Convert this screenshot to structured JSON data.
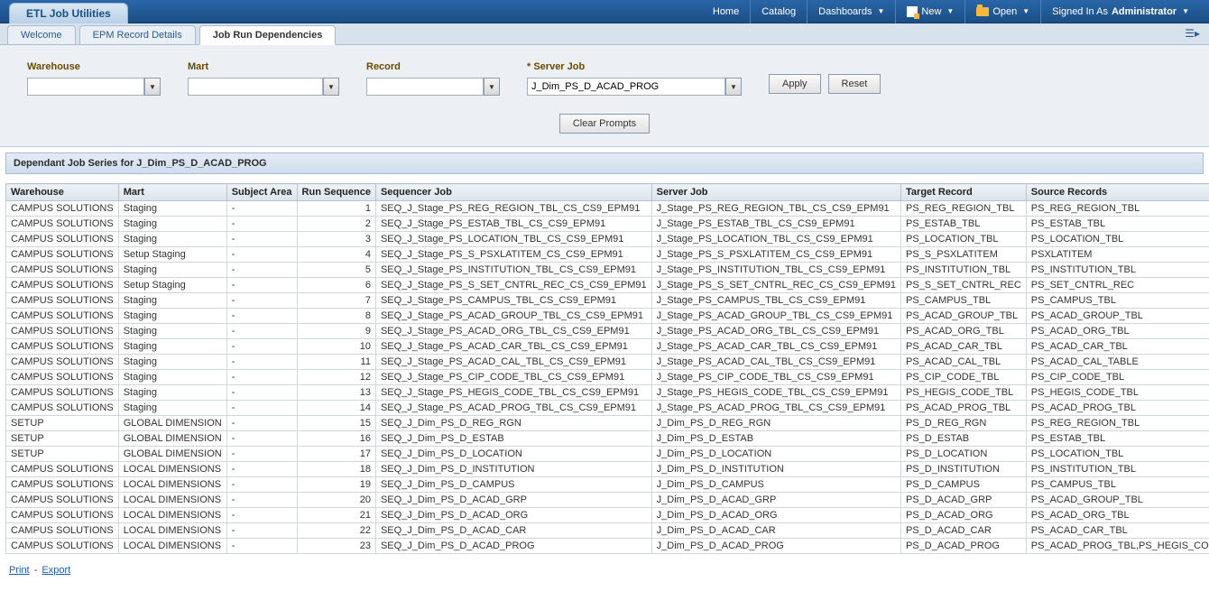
{
  "header": {
    "app_title": "ETL Job Utilities",
    "nav": {
      "home": "Home",
      "catalog": "Catalog",
      "dashboards": "Dashboards",
      "new": "New",
      "open": "Open",
      "signed_in_prefix": "Signed In As ",
      "signed_in_user": "Administrator"
    }
  },
  "tabs": {
    "items": [
      {
        "label": "Welcome",
        "active": false
      },
      {
        "label": "EPM Record Details",
        "active": false
      },
      {
        "label": "Job Run Dependencies",
        "active": true
      }
    ]
  },
  "prompts": {
    "warehouse": {
      "label": "Warehouse",
      "value": ""
    },
    "mart": {
      "label": "Mart",
      "value": ""
    },
    "record": {
      "label": "Record",
      "value": ""
    },
    "server_job": {
      "label": "* Server Job",
      "value": "J_Dim_PS_D_ACAD_PROG"
    },
    "apply": "Apply",
    "reset": "Reset",
    "clear": "Clear Prompts"
  },
  "section_title": "Dependant Job Series for J_Dim_PS_D_ACAD_PROG",
  "table": {
    "columns": [
      "Warehouse",
      "Mart",
      "Subject Area",
      "Run Sequence",
      "Sequencer Job",
      "Server Job",
      "Target Record",
      "Source Records"
    ],
    "rows": [
      {
        "warehouse": "CAMPUS SOLUTIONS",
        "mart": "Staging",
        "subject": "-",
        "seq": 1,
        "sequencer": "SEQ_J_Stage_PS_REG_REGION_TBL_CS_CS9_EPM91",
        "server": "J_Stage_PS_REG_REGION_TBL_CS_CS9_EPM91",
        "target": "PS_REG_REGION_TBL",
        "source": "PS_REG_REGION_TBL"
      },
      {
        "warehouse": "CAMPUS SOLUTIONS",
        "mart": "Staging",
        "subject": "-",
        "seq": 2,
        "sequencer": "SEQ_J_Stage_PS_ESTAB_TBL_CS_CS9_EPM91",
        "server": "J_Stage_PS_ESTAB_TBL_CS_CS9_EPM91",
        "target": "PS_ESTAB_TBL",
        "source": "PS_ESTAB_TBL"
      },
      {
        "warehouse": "CAMPUS SOLUTIONS",
        "mart": "Staging",
        "subject": "-",
        "seq": 3,
        "sequencer": "SEQ_J_Stage_PS_LOCATION_TBL_CS_CS9_EPM91",
        "server": "J_Stage_PS_LOCATION_TBL_CS_CS9_EPM91",
        "target": "PS_LOCATION_TBL",
        "source": "PS_LOCATION_TBL"
      },
      {
        "warehouse": "CAMPUS SOLUTIONS",
        "mart": "Setup Staging",
        "subject": "-",
        "seq": 4,
        "sequencer": "SEQ_J_Stage_PS_S_PSXLATITEM_CS_CS9_EPM91",
        "server": "J_Stage_PS_S_PSXLATITEM_CS_CS9_EPM91",
        "target": "PS_S_PSXLATITEM",
        "source": "PSXLATITEM"
      },
      {
        "warehouse": "CAMPUS SOLUTIONS",
        "mart": "Staging",
        "subject": "-",
        "seq": 5,
        "sequencer": "SEQ_J_Stage_PS_INSTITUTION_TBL_CS_CS9_EPM91",
        "server": "J_Stage_PS_INSTITUTION_TBL_CS_CS9_EPM91",
        "target": "PS_INSTITUTION_TBL",
        "source": "PS_INSTITUTION_TBL"
      },
      {
        "warehouse": "CAMPUS SOLUTIONS",
        "mart": "Setup Staging",
        "subject": "-",
        "seq": 6,
        "sequencer": "SEQ_J_Stage_PS_S_SET_CNTRL_REC_CS_CS9_EPM91",
        "server": "J_Stage_PS_S_SET_CNTRL_REC_CS_CS9_EPM91",
        "target": "PS_S_SET_CNTRL_REC",
        "source": "PS_SET_CNTRL_REC"
      },
      {
        "warehouse": "CAMPUS SOLUTIONS",
        "mart": "Staging",
        "subject": "-",
        "seq": 7,
        "sequencer": "SEQ_J_Stage_PS_CAMPUS_TBL_CS_CS9_EPM91",
        "server": "J_Stage_PS_CAMPUS_TBL_CS_CS9_EPM91",
        "target": "PS_CAMPUS_TBL",
        "source": "PS_CAMPUS_TBL"
      },
      {
        "warehouse": "CAMPUS SOLUTIONS",
        "mart": "Staging",
        "subject": "-",
        "seq": 8,
        "sequencer": "SEQ_J_Stage_PS_ACAD_GROUP_TBL_CS_CS9_EPM91",
        "server": "J_Stage_PS_ACAD_GROUP_TBL_CS_CS9_EPM91",
        "target": "PS_ACAD_GROUP_TBL",
        "source": "PS_ACAD_GROUP_TBL"
      },
      {
        "warehouse": "CAMPUS SOLUTIONS",
        "mart": "Staging",
        "subject": "-",
        "seq": 9,
        "sequencer": "SEQ_J_Stage_PS_ACAD_ORG_TBL_CS_CS9_EPM91",
        "server": "J_Stage_PS_ACAD_ORG_TBL_CS_CS9_EPM91",
        "target": "PS_ACAD_ORG_TBL",
        "source": "PS_ACAD_ORG_TBL"
      },
      {
        "warehouse": "CAMPUS SOLUTIONS",
        "mart": "Staging",
        "subject": "-",
        "seq": 10,
        "sequencer": "SEQ_J_Stage_PS_ACAD_CAR_TBL_CS_CS9_EPM91",
        "server": "J_Stage_PS_ACAD_CAR_TBL_CS_CS9_EPM91",
        "target": "PS_ACAD_CAR_TBL",
        "source": "PS_ACAD_CAR_TBL"
      },
      {
        "warehouse": "CAMPUS SOLUTIONS",
        "mart": "Staging",
        "subject": "-",
        "seq": 11,
        "sequencer": "SEQ_J_Stage_PS_ACAD_CAL_TBL_CS_CS9_EPM91",
        "server": "J_Stage_PS_ACAD_CAL_TBL_CS_CS9_EPM91",
        "target": "PS_ACAD_CAL_TBL",
        "source": "PS_ACAD_CAL_TABLE"
      },
      {
        "warehouse": "CAMPUS SOLUTIONS",
        "mart": "Staging",
        "subject": "-",
        "seq": 12,
        "sequencer": "SEQ_J_Stage_PS_CIP_CODE_TBL_CS_CS9_EPM91",
        "server": "J_Stage_PS_CIP_CODE_TBL_CS_CS9_EPM91",
        "target": "PS_CIP_CODE_TBL",
        "source": "PS_CIP_CODE_TBL"
      },
      {
        "warehouse": "CAMPUS SOLUTIONS",
        "mart": "Staging",
        "subject": "-",
        "seq": 13,
        "sequencer": "SEQ_J_Stage_PS_HEGIS_CODE_TBL_CS_CS9_EPM91",
        "server": "J_Stage_PS_HEGIS_CODE_TBL_CS_CS9_EPM91",
        "target": "PS_HEGIS_CODE_TBL",
        "source": "PS_HEGIS_CODE_TBL"
      },
      {
        "warehouse": "CAMPUS SOLUTIONS",
        "mart": "Staging",
        "subject": "-",
        "seq": 14,
        "sequencer": "SEQ_J_Stage_PS_ACAD_PROG_TBL_CS_CS9_EPM91",
        "server": "J_Stage_PS_ACAD_PROG_TBL_CS_CS9_EPM91",
        "target": "PS_ACAD_PROG_TBL",
        "source": "PS_ACAD_PROG_TBL"
      },
      {
        "warehouse": "SETUP",
        "mart": "GLOBAL DIMENSION",
        "subject": "-",
        "seq": 15,
        "sequencer": "SEQ_J_Dim_PS_D_REG_RGN",
        "server": "J_Dim_PS_D_REG_RGN",
        "target": "PS_D_REG_RGN",
        "source": "PS_REG_REGION_TBL"
      },
      {
        "warehouse": "SETUP",
        "mart": "GLOBAL DIMENSION",
        "subject": "-",
        "seq": 16,
        "sequencer": "SEQ_J_Dim_PS_D_ESTAB",
        "server": "J_Dim_PS_D_ESTAB",
        "target": "PS_D_ESTAB",
        "source": "PS_ESTAB_TBL"
      },
      {
        "warehouse": "SETUP",
        "mart": "GLOBAL DIMENSION",
        "subject": "-",
        "seq": 17,
        "sequencer": "SEQ_J_Dim_PS_D_LOCATION",
        "server": "J_Dim_PS_D_LOCATION",
        "target": "PS_D_LOCATION",
        "source": "PS_LOCATION_TBL"
      },
      {
        "warehouse": "CAMPUS SOLUTIONS",
        "mart": "LOCAL DIMENSIONS",
        "subject": "-",
        "seq": 18,
        "sequencer": "SEQ_J_Dim_PS_D_INSTITUTION",
        "server": "J_Dim_PS_D_INSTITUTION",
        "target": "PS_D_INSTITUTION",
        "source": "PS_INSTITUTION_TBL"
      },
      {
        "warehouse": "CAMPUS SOLUTIONS",
        "mart": "LOCAL DIMENSIONS",
        "subject": "-",
        "seq": 19,
        "sequencer": "SEQ_J_Dim_PS_D_CAMPUS",
        "server": "J_Dim_PS_D_CAMPUS",
        "target": "PS_D_CAMPUS",
        "source": "PS_CAMPUS_TBL"
      },
      {
        "warehouse": "CAMPUS SOLUTIONS",
        "mart": "LOCAL DIMENSIONS",
        "subject": "-",
        "seq": 20,
        "sequencer": "SEQ_J_Dim_PS_D_ACAD_GRP",
        "server": "J_Dim_PS_D_ACAD_GRP",
        "target": "PS_D_ACAD_GRP",
        "source": "PS_ACAD_GROUP_TBL"
      },
      {
        "warehouse": "CAMPUS SOLUTIONS",
        "mart": "LOCAL DIMENSIONS",
        "subject": "-",
        "seq": 21,
        "sequencer": "SEQ_J_Dim_PS_D_ACAD_ORG",
        "server": "J_Dim_PS_D_ACAD_ORG",
        "target": "PS_D_ACAD_ORG",
        "source": "PS_ACAD_ORG_TBL"
      },
      {
        "warehouse": "CAMPUS SOLUTIONS",
        "mart": "LOCAL DIMENSIONS",
        "subject": "-",
        "seq": 22,
        "sequencer": "SEQ_J_Dim_PS_D_ACAD_CAR",
        "server": "J_Dim_PS_D_ACAD_CAR",
        "target": "PS_D_ACAD_CAR",
        "source": "PS_ACAD_CAR_TBL"
      },
      {
        "warehouse": "CAMPUS SOLUTIONS",
        "mart": "LOCAL DIMENSIONS",
        "subject": "-",
        "seq": 23,
        "sequencer": "SEQ_J_Dim_PS_D_ACAD_PROG",
        "server": "J_Dim_PS_D_ACAD_PROG",
        "target": "PS_D_ACAD_PROG",
        "source": "PS_ACAD_PROG_TBL,PS_HEGIS_CODE_TBL, PS_CIP_CODE_TBL,PS_ACAD_CAL_TBL"
      }
    ]
  },
  "footer": {
    "print": "Print",
    "export": "Export"
  }
}
